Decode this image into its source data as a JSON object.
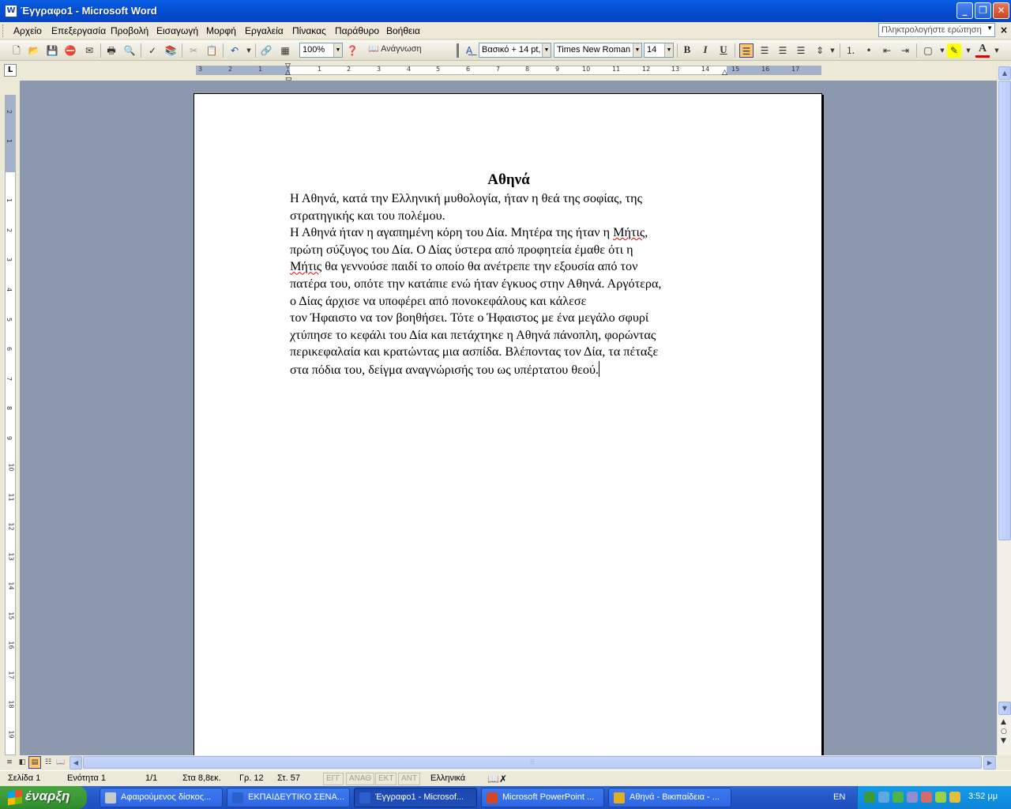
{
  "window": {
    "title": "Έγγραφο1 - Microsoft Word",
    "app_icon": "W"
  },
  "menu": {
    "items": [
      "Αρχείο",
      "Επεξεργασία",
      "Προβολή",
      "Εισαγωγή",
      "Μορφή",
      "Εργαλεία",
      "Πίνακας",
      "Παράθυρο",
      "Βοήθεια"
    ],
    "help_placeholder": "Πληκτρολογήστε ερώτηση"
  },
  "toolbar": {
    "zoom": "100%",
    "reading": "Ανάγνωση",
    "style": "Βασικό + 14 pt,",
    "font": "Times New Roman",
    "size": "14",
    "bold": "B",
    "italic": "I",
    "underline": "U"
  },
  "ruler": {
    "h_labels": [
      "3",
      "2",
      "1",
      "1",
      "2",
      "3",
      "4",
      "5",
      "6",
      "7",
      "8",
      "9",
      "10",
      "11",
      "12",
      "13",
      "14",
      "15",
      "16",
      "17"
    ],
    "v_labels": [
      "2",
      "1",
      "1",
      "2",
      "3",
      "4",
      "5",
      "6",
      "7",
      "8",
      "9",
      "10",
      "11",
      "12",
      "13",
      "14",
      "15",
      "16",
      "17",
      "18",
      "19"
    ]
  },
  "document": {
    "title": "Αθηνά",
    "lines": [
      "Η Αθηνά, κατά την Ελληνική μυθολογία, ήταν η θεά της σοφίας, της",
      "στρατηγικής και του πολέμου.",
      "Η Αθηνά ήταν η αγαπημένη κόρη του Δία. Μητέρα της ήταν η Μήτις,",
      "πρώτη σύζυγος του Δία. Ο Δίας ύστερα από προφητεία έμαθε ότι η",
      "Μήτις θα γεννούσε παιδί το οποίο θα ανέτρεπε την εξουσία από τον",
      "πατέρα του, οπότε την κατάπιε ενώ ήταν έγκυος στην Αθηνά. Αργότερα,",
      "ο Δίας άρχισε να υποφέρει από πονοκεφάλους και κάλεσε",
      "τον Ήφαιστο να τον βοηθήσει. Τότε ο Ήφαιστος με ένα μεγάλο σφυρί",
      "χτύπησε το κεφάλι του Δία και πετάχτηκε η Αθηνά πάνοπλη, φορώντας",
      "περικεφαλαία και κρατώντας μια ασπίδα. Βλέποντας τον Δία, τα πέταξε",
      "στα πόδια του, δείγμα αναγνώρισής του ως υπέρτατου θεού."
    ],
    "misspelled_word": "Μήτις"
  },
  "status": {
    "page": "Σελίδα 1",
    "section": "Ενότητα 1",
    "pages": "1/1",
    "at": "Στα 8,8εκ.",
    "line": "Γρ. 12",
    "col": "Στ. 57",
    "rec": "ΕΓΓ",
    "trk": "ΑΝΑΘ",
    "ext": "ΕΚΤ",
    "ovr": "ΑΝΤ",
    "language": "Ελληνικά"
  },
  "taskbar": {
    "start": "έναρξη",
    "tasks": [
      {
        "label": "Αφαιρούμενος δίσκος...",
        "icon_color": "#c9c9c9"
      },
      {
        "label": "ΕΚΠΑΙΔΕΥΤΙΚΟ ΣΕΝΑ...",
        "icon_color": "#2b5fce"
      },
      {
        "label": "Έγγραφο1 - Microsof...",
        "icon_color": "#2b5fce"
      },
      {
        "label": "Microsoft PowerPoint ...",
        "icon_color": "#d24726"
      },
      {
        "label": "Αθηνά - Βικιπαίδεια - ...",
        "icon_color": "#e0b020"
      }
    ],
    "lang": "EN",
    "clock": "3:52 μμ"
  }
}
